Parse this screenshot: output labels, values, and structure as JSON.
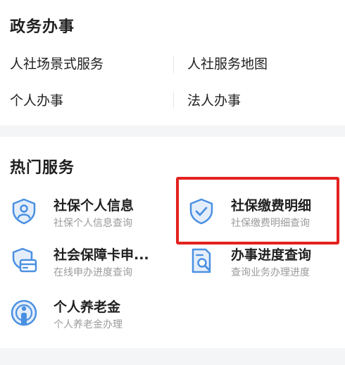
{
  "gov_section": {
    "title": "政务办事",
    "links": [
      "人社场景式服务",
      "人社服务地图",
      "个人办事",
      "法人办事"
    ]
  },
  "hot_section": {
    "title": "热门服务",
    "services": [
      {
        "title": "社保个人信息",
        "subtitle": "社保个人信息查询",
        "icon": "person-shield-icon"
      },
      {
        "title": "社保缴费明细",
        "subtitle": "社保缴费明细查询",
        "icon": "check-shield-icon"
      },
      {
        "title": "社会保障卡申...",
        "subtitle": "在线申办进度查询",
        "icon": "card-shield-icon"
      },
      {
        "title": "办事进度查询",
        "subtitle": "查询业务办理进度",
        "icon": "document-search-icon"
      },
      {
        "title": "个人养老金",
        "subtitle": "个人养老金办理",
        "icon": "pension-person-icon"
      }
    ]
  },
  "colors": {
    "icon_blue": "#4a90e2",
    "highlight_red": "#e3211f",
    "subtitle_gray": "#9b9b9b"
  }
}
